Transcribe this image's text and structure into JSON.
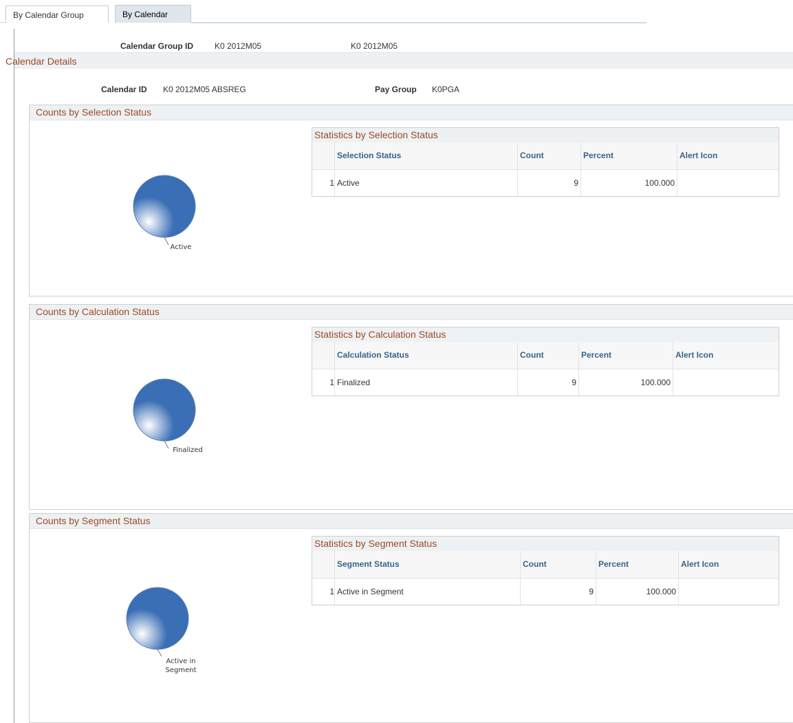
{
  "tabs": [
    {
      "label": "By Calendar Group",
      "active": false
    },
    {
      "label": "By Calendar",
      "active": true
    }
  ],
  "calendar_group": {
    "label": "Calendar Group ID",
    "value": "K0 2012M05",
    "description": "K0 2012M05"
  },
  "calendar_details": {
    "heading": "Calendar Details",
    "calendar_id_label": "Calendar ID",
    "calendar_id_value": "K0 2012M05 ABSREG",
    "pay_group_label": "Pay Group",
    "pay_group_value": "K0PGA"
  },
  "sections": [
    {
      "heading": "Counts by Selection Status",
      "grid_title": "Statistics by Selection Status",
      "columns": [
        "Selection Status",
        "Count",
        "Percent",
        "Alert Icon"
      ],
      "rows": [
        {
          "num": "1",
          "status": "Active",
          "count": "9",
          "percent": "100.000",
          "alert": ""
        }
      ],
      "pie": {
        "slices": [
          {
            "label": "Active",
            "value": 9
          }
        ],
        "color": "#3a6eb5",
        "label_lines": [
          "Active"
        ]
      }
    },
    {
      "heading": "Counts by Calculation Status",
      "grid_title": "Statistics by Calculation Status",
      "columns": [
        "Calculation Status",
        "Count",
        "Percent",
        "Alert Icon"
      ],
      "rows": [
        {
          "num": "1",
          "status": "Finalized",
          "count": "9",
          "percent": "100.000",
          "alert": ""
        }
      ],
      "pie": {
        "slices": [
          {
            "label": "Finalized",
            "value": 9
          }
        ],
        "color": "#3a6eb5",
        "label_lines": [
          "Finalized"
        ]
      }
    },
    {
      "heading": "Counts by Segment Status",
      "grid_title": "Statistics by Segment Status",
      "columns": [
        "Segment Status",
        "Count",
        "Percent",
        "Alert Icon"
      ],
      "rows": [
        {
          "num": "1",
          "status": "Active in Segment",
          "count": "9",
          "percent": "100.000",
          "alert": ""
        }
      ],
      "pie": {
        "slices": [
          {
            "label": "Active in Segment",
            "value": 9
          }
        ],
        "color": "#3a6eb5",
        "label_lines": [
          "Active in",
          "Segment"
        ]
      }
    }
  ]
}
